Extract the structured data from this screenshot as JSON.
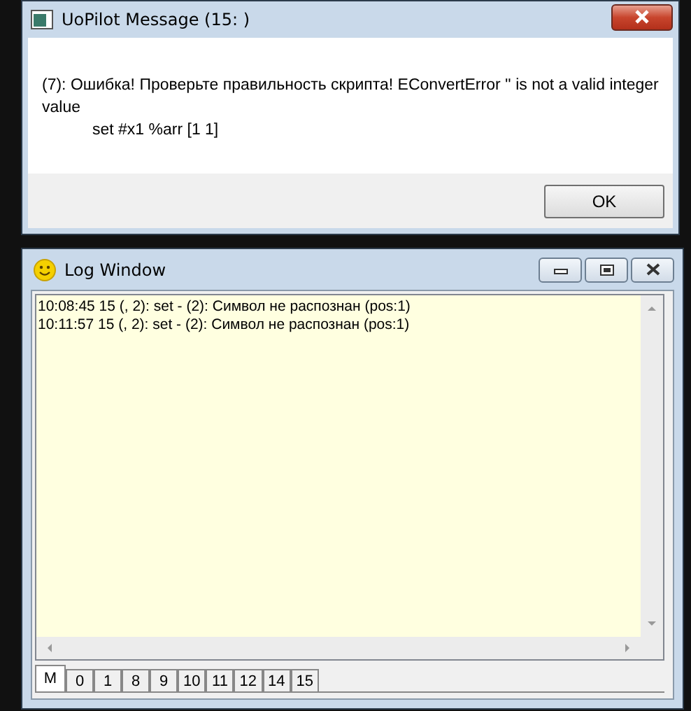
{
  "message_window": {
    "title": "UoPilot Message  (15: )",
    "text": "(7): Ошибка! Проверьте правильность скрипта! EConvertError '' is not a valid integer value",
    "code_line": "set #x1 %arr [1 1]",
    "buttons": [
      "OK"
    ]
  },
  "log_window": {
    "title": "Log Window",
    "lines": [
      "10:08:45 15 (, 2): set - (2): Символ не распознан (pos:1)",
      "10:11:57 15 (, 2): set - (2): Символ не распознан (pos:1)"
    ],
    "tabs": [
      {
        "label": "M",
        "selected": true
      },
      {
        "label": "0",
        "selected": false
      },
      {
        "label": "1",
        "selected": false
      },
      {
        "label": "8",
        "selected": false
      },
      {
        "label": "9",
        "selected": false
      },
      {
        "label": "10",
        "selected": false
      },
      {
        "label": "11",
        "selected": false
      },
      {
        "label": "12",
        "selected": false
      },
      {
        "label": "14",
        "selected": false
      },
      {
        "label": "15",
        "selected": false
      }
    ]
  }
}
